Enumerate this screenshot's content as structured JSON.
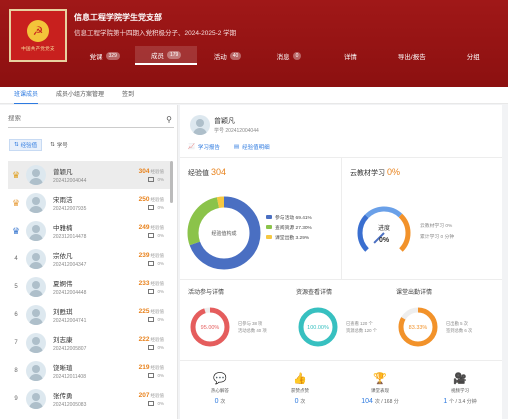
{
  "header": {
    "logo_text": "中国共产党党支",
    "title": "信息工程学院学生党支部",
    "subtitle": "信息工程学院第十四期入党积极分子、2024-2025-2 学期",
    "nav": [
      {
        "label": "党课",
        "badge": "329",
        "active": false
      },
      {
        "label": "成员",
        "badge": "179",
        "active": true
      },
      {
        "label": "活动",
        "badge": "40",
        "active": false
      },
      {
        "label": "消息",
        "badge": "0",
        "active": false
      },
      {
        "label": "详情",
        "badge": "",
        "active": false
      },
      {
        "label": "导出/报告",
        "badge": "",
        "active": false
      },
      {
        "label": "分组",
        "badge": "",
        "active": false
      }
    ]
  },
  "tabs": [
    "班课成员",
    "成员小组方案管理",
    "签到"
  ],
  "left": {
    "search_placeholder": "搜索",
    "sort_exp": "经验值",
    "sort_id": "学号",
    "members": [
      {
        "rank": "crown",
        "crown_color": "#e0a020",
        "name": "曾颖凡",
        "id": "202412004044",
        "score": "304",
        "unit": "经验值",
        "pct": "0%",
        "selected": true
      },
      {
        "rank": "crown",
        "crown_color": "#e8a040",
        "name": "宋雨洁",
        "id": "202412007935",
        "score": "250",
        "unit": "经验值",
        "pct": "0%",
        "selected": false
      },
      {
        "rank": "crown",
        "crown_color": "#3a78d0",
        "name": "中雅楠",
        "id": "202312014478",
        "score": "249",
        "unit": "经验值",
        "pct": "0%",
        "selected": false
      },
      {
        "rank": "4",
        "crown_color": "",
        "name": "宗依凡",
        "id": "202412004347",
        "score": "239",
        "unit": "经验值",
        "pct": "0%",
        "selected": false
      },
      {
        "rank": "5",
        "crown_color": "",
        "name": "夏婀伟",
        "id": "202412004448",
        "score": "233",
        "unit": "经验值",
        "pct": "0%",
        "selected": false
      },
      {
        "rank": "6",
        "crown_color": "",
        "name": "刘甦琪",
        "id": "202412004741",
        "score": "225",
        "unit": "经验值",
        "pct": "0%",
        "selected": false
      },
      {
        "rank": "7",
        "crown_color": "",
        "name": "刘志康",
        "id": "202412005807",
        "score": "222",
        "unit": "经验值",
        "pct": "0%",
        "selected": false
      },
      {
        "rank": "8",
        "crown_color": "",
        "name": "饶晰瑄",
        "id": "202412011408",
        "score": "219",
        "unit": "经验值",
        "pct": "0%",
        "selected": false
      },
      {
        "rank": "9",
        "crown_color": "",
        "name": "张传勇",
        "id": "202412005083",
        "score": "207",
        "unit": "经验值",
        "pct": "0%",
        "selected": false
      }
    ]
  },
  "profile": {
    "name": "曾颖凡",
    "id": "学号 202412004044",
    "link_report": "学习报告",
    "link_exp": "经验值明细"
  },
  "exp": {
    "title": "经验值",
    "value": "304",
    "donut_label": "经验值构成",
    "legend": [
      {
        "label": "参与活动 69.41%",
        "color": "#4a6fc2",
        "pct": 69.41
      },
      {
        "label": "查阅资源 27.30%",
        "color": "#8bc34a",
        "pct": 27.3
      },
      {
        "label": "课堂出勤 3.29%",
        "color": "#f5c842",
        "pct": 3.29
      }
    ]
  },
  "cloud": {
    "title": "云教材学习",
    "value": "0%",
    "gauge_label": "进度",
    "gauge_value": "0%",
    "line1": "云教材学习 0%",
    "line2": "累计学习 0 分钟"
  },
  "stats": [
    {
      "title": "活动参与详情",
      "pct_text": "95.00%",
      "pct": 95,
      "color": "#e55d5d",
      "l1": "已参与 38 项",
      "l2": "活动总数 40 项"
    },
    {
      "title": "资源查看详情",
      "pct_text": "100.00%",
      "pct": 100,
      "color": "#37c0c0",
      "l1": "已查看 120 个",
      "l2": "资源总数 120 个"
    },
    {
      "title": "课堂出勤详情",
      "pct_text": "83.33%",
      "pct": 83.33,
      "color": "#f2922a",
      "l1": "已出勤 5 次",
      "l2": "签到总数 6 次"
    }
  ],
  "bottom": [
    {
      "label": "热心解答",
      "value": "0",
      "unit": "次",
      "icon": "chat-icon",
      "color": "#7a67d8"
    },
    {
      "label": "获赞点赞",
      "value": "0",
      "unit": "次",
      "icon": "thumbs-up-icon",
      "color": "#f2a33a"
    },
    {
      "label": "课堂表现",
      "value": "104",
      "unit": "次 / 168 分",
      "icon": "podium-icon",
      "color": "#f2c23a"
    },
    {
      "label": "视频学习",
      "value": "1",
      "unit": "个 / 3.4 分钟",
      "icon": "video-icon",
      "color": "#2d8ae0"
    }
  ]
}
